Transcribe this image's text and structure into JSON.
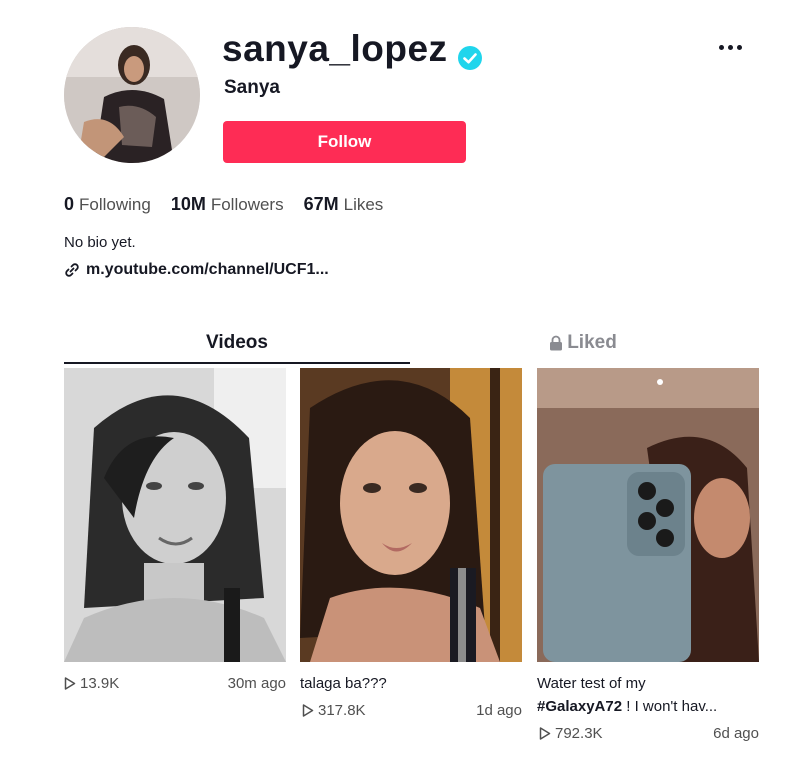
{
  "profile": {
    "username": "sanya_lopez",
    "nickname": "Sanya",
    "verified": true,
    "follow_label": "Follow",
    "more_icon": "ellipsis-icon",
    "stats": {
      "following_count": "0",
      "following_label": "Following",
      "followers_count": "10M",
      "followers_label": "Followers",
      "likes_count": "67M",
      "likes_label": "Likes"
    },
    "bio": "No bio yet.",
    "link": "m.youtube.com/channel/UCF1..."
  },
  "tabs": {
    "videos": "Videos",
    "liked": "Liked"
  },
  "videos": [
    {
      "caption": "",
      "plays": "13.9K",
      "time": "30m ago"
    },
    {
      "caption": "talaga ba???",
      "plays": "317.8K",
      "time": "1d ago"
    },
    {
      "caption_line1": "Water test of my",
      "caption_hashtag": "#GalaxyA72",
      "caption_rest": " ! I won't hav...",
      "plays": "792.3K",
      "time": "6d ago"
    }
  ],
  "colors": {
    "follow_button": "#fe2c55",
    "verified_badge": "#20d5ec",
    "text_primary": "#161823",
    "text_secondary": "#505050",
    "tab_inactive": "#8a8b91"
  }
}
